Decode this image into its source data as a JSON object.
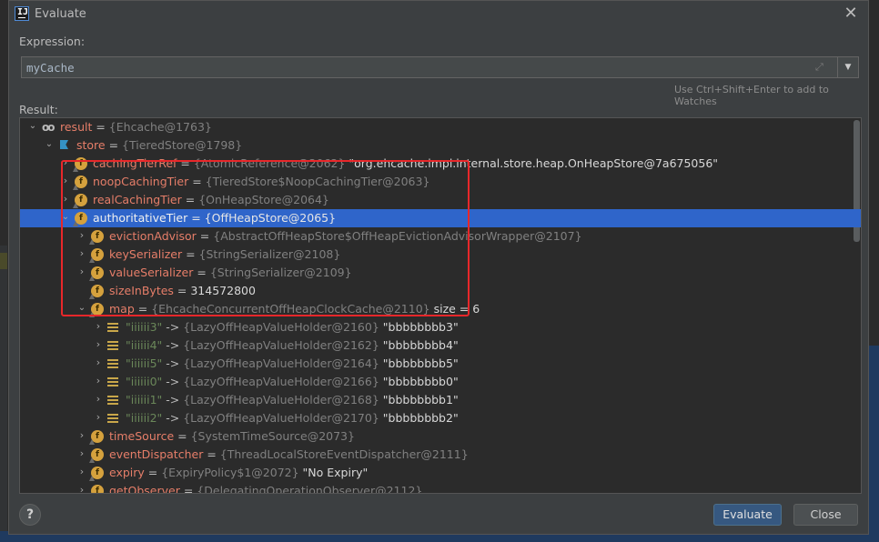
{
  "dialog": {
    "title": "Evaluate",
    "close_glyph": "✕"
  },
  "expression": {
    "label": "Expression:",
    "value": "myCache",
    "hint": "Use Ctrl+Shift+Enter to add to Watches"
  },
  "result": {
    "label": "Result:",
    "rows": [
      {
        "name": "result",
        "ref": "{Ehcache@1763}",
        "tail": "",
        "icon": "watch-glasses-icon",
        "expanded": true
      },
      {
        "name": "store",
        "ref": "{TieredStore@1798}",
        "tail": "",
        "icon": "flag-icon",
        "expanded": true
      },
      {
        "name": "cachingTierRef",
        "ref": "{AtomicReference@2062}",
        "tail": "\"org.ehcache.impl.internal.store.heap.OnHeapStore@7a675056\"",
        "icon": "field-icon"
      },
      {
        "name": "noopCachingTier",
        "ref": "{TieredStore$NoopCachingTier@2063}",
        "tail": "",
        "icon": "field-icon"
      },
      {
        "name": "realCachingTier",
        "ref": "{OnHeapStore@2064}",
        "tail": "",
        "icon": "field-icon"
      },
      {
        "name": "authoritativeTier",
        "ref": "{OffHeapStore@2065}",
        "tail": "",
        "icon": "field-icon",
        "expanded": true,
        "selected": true
      },
      {
        "name": "evictionAdvisor",
        "ref": "{AbstractOffHeapStore$OffHeapEvictionAdvisorWrapper@2107}",
        "tail": "",
        "icon": "field-icon"
      },
      {
        "name": "keySerializer",
        "ref": "{StringSerializer@2108}",
        "tail": "",
        "icon": "field-icon"
      },
      {
        "name": "valueSerializer",
        "ref": "{StringSerializer@2109}",
        "tail": "",
        "icon": "field-icon"
      },
      {
        "name": "sizeInBytes",
        "ref": "",
        "tail": "314572800",
        "icon": "field-icon"
      },
      {
        "name": "map",
        "ref": "{EhcacheConcurrentOffHeapClockCache@2110}",
        "tail": " size = 6",
        "icon": "field-icon",
        "expanded": true
      },
      {
        "name": "\"iiiiii3\"",
        "ref": "{LazyOffHeapValueHolder@2160}",
        "tail": "\"bbbbbbbb3\"",
        "icon": "map-entry-icon"
      },
      {
        "name": "\"iiiiii4\"",
        "ref": "{LazyOffHeapValueHolder@2162}",
        "tail": "\"bbbbbbbb4\"",
        "icon": "map-entry-icon"
      },
      {
        "name": "\"iiiiii5\"",
        "ref": "{LazyOffHeapValueHolder@2164}",
        "tail": "\"bbbbbbbb5\"",
        "icon": "map-entry-icon"
      },
      {
        "name": "\"iiiiii0\"",
        "ref": "{LazyOffHeapValueHolder@2166}",
        "tail": "\"bbbbbbbb0\"",
        "icon": "map-entry-icon"
      },
      {
        "name": "\"iiiiii1\"",
        "ref": "{LazyOffHeapValueHolder@2168}",
        "tail": "\"bbbbbbbb1\"",
        "icon": "map-entry-icon"
      },
      {
        "name": "\"iiiiii2\"",
        "ref": "{LazyOffHeapValueHolder@2170}",
        "tail": "\"bbbbbbbb2\"",
        "icon": "map-entry-icon"
      },
      {
        "name": "timeSource",
        "ref": "{SystemTimeSource@2073}",
        "tail": "",
        "icon": "field-icon"
      },
      {
        "name": "eventDispatcher",
        "ref": "{ThreadLocalStoreEventDispatcher@2111}",
        "tail": "",
        "icon": "field-icon"
      },
      {
        "name": "expiry",
        "ref": "{ExpiryPolicy$1@2072}",
        "tail": "\"No Expiry\"",
        "icon": "field-icon"
      },
      {
        "name": "getObserver",
        "ref": "{DelegatingOperationObserver@2112}",
        "tail": "",
        "icon": "field-icon"
      }
    ]
  },
  "buttons": {
    "help": "?",
    "evaluate": "Evaluate",
    "close": "Close"
  },
  "colors": {
    "selection": "#2f65ca",
    "field_name": "#e67e69",
    "map_key": "#6a8759",
    "highlight_box": "#e8272a",
    "primary_button": "#365880"
  }
}
